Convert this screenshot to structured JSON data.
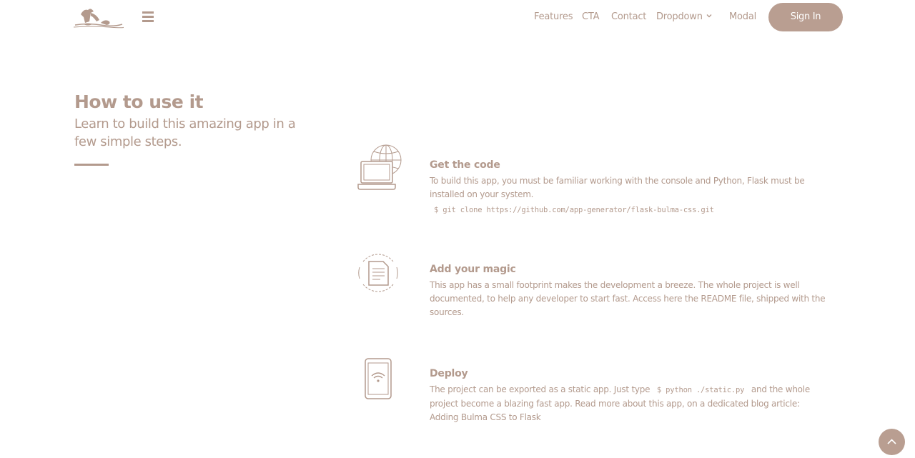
{
  "nav": {
    "items": [
      "Features",
      "CTA",
      "Contact",
      "Dropdown",
      "Modal"
    ],
    "signin_label": "Sign In"
  },
  "section": {
    "title": "How to use it",
    "subtitle": "Learn to build this amazing app in a few simple steps."
  },
  "steps": [
    {
      "icon": "laptop-globe-icon",
      "title": "Get the code",
      "text": "To build this app, you must be familiar working with the console and Python, Flask must be installed on your system.",
      "code": "$ git clone https://github.com/app-generator/flask-bulma-css.git"
    },
    {
      "icon": "document-cycle-icon",
      "title": "Add your magic",
      "text": "This app has a small footprint makes the development a breeze. The whole project is well documented, to help any developer to start fast. Access here the README file, shipped with the sources."
    },
    {
      "icon": "mobile-wifi-icon",
      "title": "Deploy",
      "text_before": "The project can be exported as a static app. Just type",
      "code": "$ python ./static.py",
      "text_after": "and the whole project become a blazing fast app. Read more about this app, on a dedicated blog article:",
      "link": "Adding Bulma CSS to Flask"
    }
  ],
  "colors": {
    "accent": "#b99e91",
    "text": "#b39a8d"
  }
}
